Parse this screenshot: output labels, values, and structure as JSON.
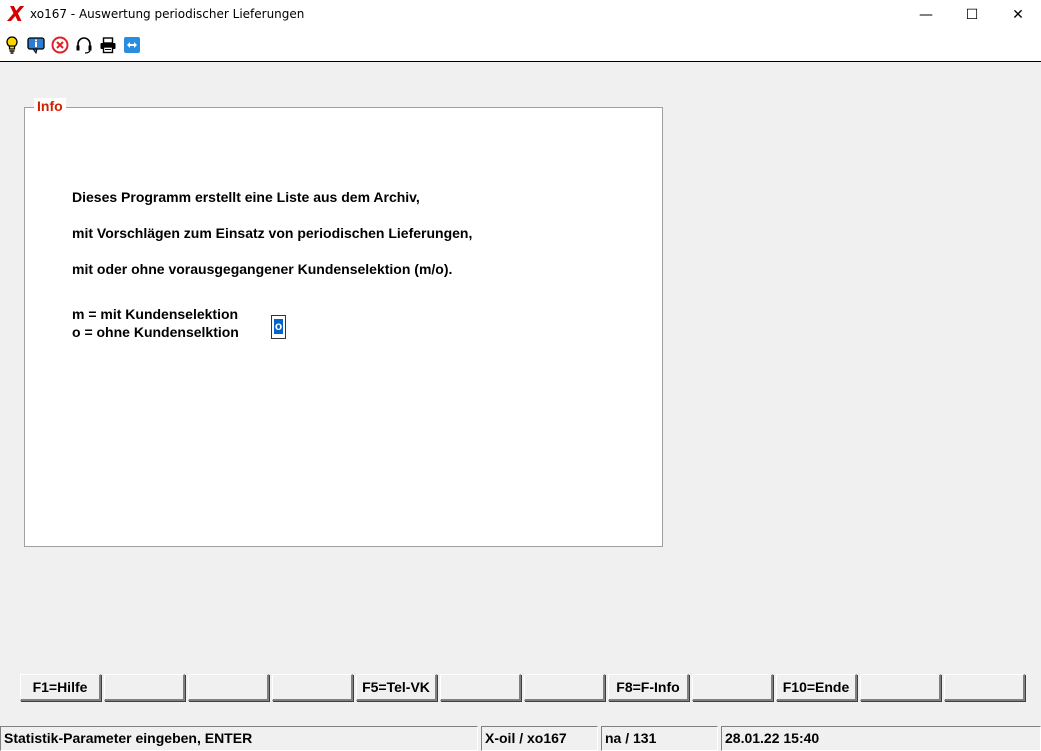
{
  "window": {
    "title": "xo167 - Auswertung periodischer Lieferungen",
    "logo": "X",
    "minimize_glyph": "—",
    "maximize_glyph": "☐",
    "close_glyph": "✕"
  },
  "toolbar": {
    "icons": [
      "lightbulb-icon",
      "info-icon",
      "stop-icon",
      "headset-icon",
      "printer-icon",
      "remote-icon"
    ]
  },
  "info": {
    "legend": "Info",
    "lines": [
      "Dieses Programm erstellt eine Liste aus dem Archiv,",
      "mit Vorschlägen zum Einsatz von periodischen Lieferungen,",
      "mit oder ohne vorausgegangener Kundenselektion (m/o)."
    ],
    "option_m": "m = mit Kundenselektion",
    "option_o": "o = ohne Kundenselktion",
    "selection_value": "o"
  },
  "function_keys": [
    "F1=Hilfe",
    "",
    "",
    "",
    "F5=Tel-VK",
    "",
    "",
    "F8=F-Info",
    "",
    "F10=Ende",
    "",
    ""
  ],
  "statusbar": {
    "message": "Statistik-Parameter eingeben, ENTER",
    "program": "X-oil / xo167",
    "user": "na / 131",
    "datetime": "28.01.22 15:40"
  },
  "colors": {
    "legend": "#d02000",
    "logo": "#d40000",
    "selection": "#0066cc"
  }
}
